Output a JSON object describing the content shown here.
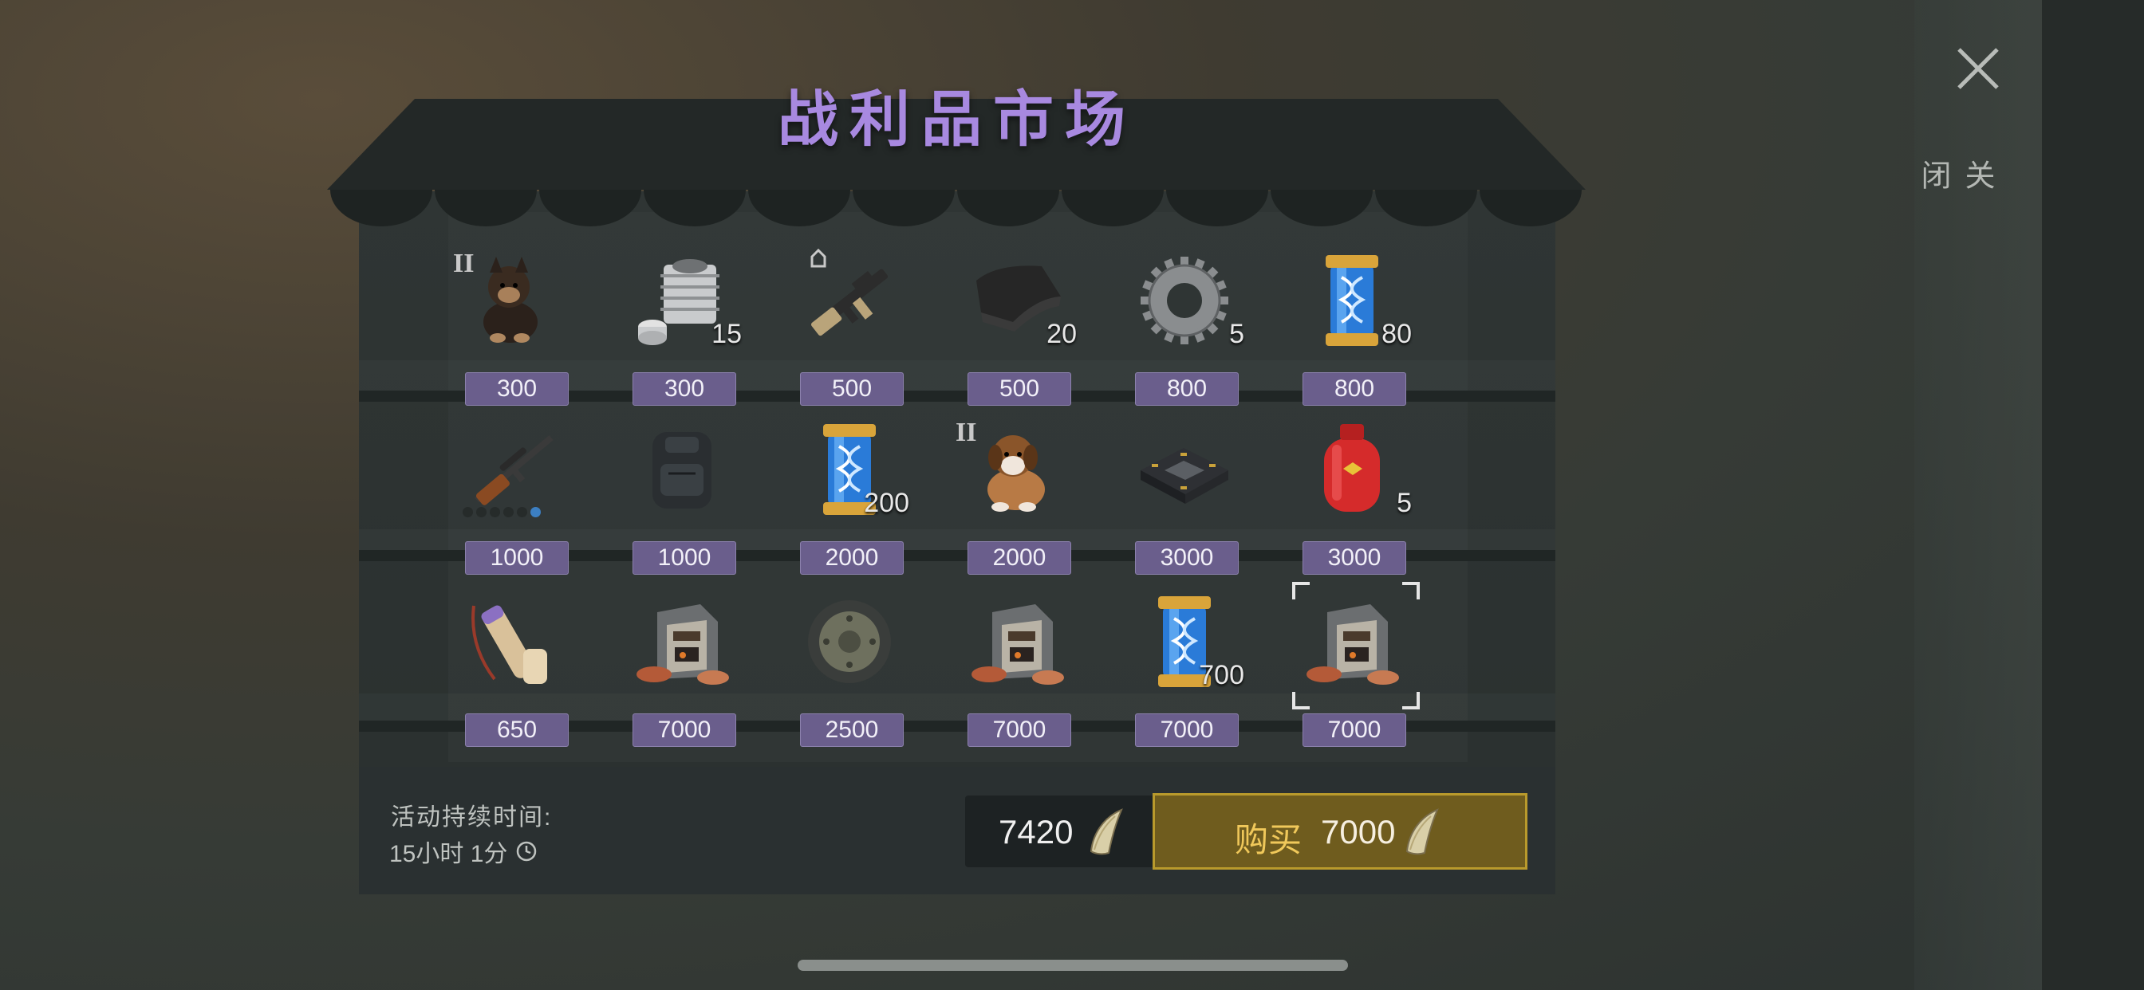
{
  "title": "战利品市场",
  "close": {
    "label": "关闭",
    "icon": "close-icon"
  },
  "colors": {
    "title": "#a889e0",
    "price_tag": "#6a5e8c",
    "buy_button": "#6f5c1e",
    "buy_label": "#f0c85a"
  },
  "items": [
    {
      "name": "dog-shepherd",
      "icon": "puppy-shepherd-icon",
      "tier": "II",
      "qty": "",
      "price": "300"
    },
    {
      "name": "engine-cylinder",
      "icon": "engine-cylinder-icon",
      "tier": "",
      "qty": "15",
      "price": "300"
    },
    {
      "name": "assault-rifle",
      "icon": "assault-rifle-icon",
      "tier": "",
      "qty": "",
      "price": "500"
    },
    {
      "name": "cloth",
      "icon": "cloth-icon",
      "tier": "",
      "qty": "20",
      "price": "500"
    },
    {
      "name": "gear",
      "icon": "gear-icon",
      "tier": "",
      "qty": "5",
      "price": "800"
    },
    {
      "name": "dna-capsule",
      "icon": "dna-capsule-icon",
      "tier": "",
      "qty": "80",
      "price": "800"
    },
    {
      "name": "sniper-rifle",
      "icon": "sniper-rifle-icon",
      "tier": "",
      "qty": "",
      "price": "1000",
      "level": 6,
      "level_max": 6
    },
    {
      "name": "backpack",
      "icon": "backpack-icon",
      "tier": "",
      "qty": "",
      "price": "1000"
    },
    {
      "name": "dna-capsule",
      "icon": "dna-capsule-icon",
      "tier": "",
      "qty": "200",
      "price": "2000"
    },
    {
      "name": "dog-saint-bernard",
      "icon": "puppy-saint-bernard-icon",
      "tier": "II",
      "qty": "",
      "price": "2000"
    },
    {
      "name": "circuit-chip",
      "icon": "circuit-chip-icon",
      "tier": "",
      "qty": "",
      "price": "3000"
    },
    {
      "name": "gas-canister",
      "icon": "gas-canister-icon",
      "tier": "",
      "qty": "5",
      "price": "3000"
    },
    {
      "name": "scroll-tube",
      "icon": "scroll-tube-icon",
      "tier": "",
      "qty": "",
      "price": "650"
    },
    {
      "name": "ore-crate-red",
      "icon": "ore-crate-icon",
      "tier": "",
      "qty": "",
      "price": "7000"
    },
    {
      "name": "wheel",
      "icon": "wheel-icon",
      "tier": "",
      "qty": "",
      "price": "2500"
    },
    {
      "name": "ore-crate-sand",
      "icon": "ore-crate-icon",
      "tier": "",
      "qty": "",
      "price": "7000"
    },
    {
      "name": "dna-capsule",
      "icon": "dna-capsule-icon",
      "tier": "",
      "qty": "700",
      "price": "7000"
    },
    {
      "name": "ore-crate-white",
      "icon": "ore-crate-icon",
      "tier": "",
      "qty": "",
      "price": "7000",
      "selected": true
    }
  ],
  "footer": {
    "duration_label": "活动持续时间:",
    "duration_value": "15小时 1分",
    "balance": "7420",
    "currency_icon": "fang-tooth-icon",
    "buy_label": "购买",
    "buy_price": "7000"
  }
}
